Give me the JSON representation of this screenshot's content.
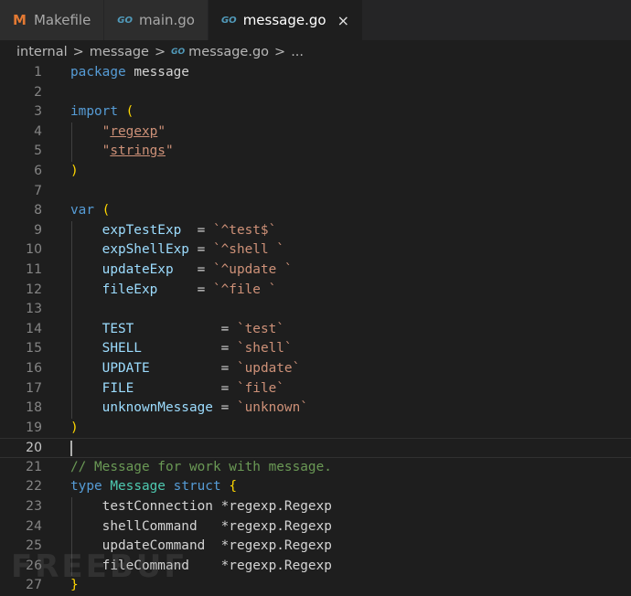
{
  "tabs": [
    {
      "label": "Makefile",
      "icon": "M"
    },
    {
      "label": "main.go",
      "icon": "GO"
    },
    {
      "label": "message.go",
      "icon": "GO",
      "close": "×"
    }
  ],
  "breadcrumb": {
    "folder1": "internal",
    "folder2": "message",
    "file": "message.go",
    "more": "...",
    "sep": ">",
    "file_icon": "GO"
  },
  "lines": [
    {
      "n": "1",
      "tokens": [
        [
          "kw",
          "package"
        ],
        [
          "df",
          " message"
        ]
      ]
    },
    {
      "n": "2",
      "tokens": []
    },
    {
      "n": "3",
      "tokens": [
        [
          "kw",
          "import"
        ],
        [
          "df",
          " "
        ],
        [
          "br",
          "("
        ]
      ]
    },
    {
      "n": "4",
      "tokens": [
        [
          "df",
          "    "
        ],
        [
          "str",
          "\""
        ],
        [
          "strul",
          "regexp"
        ],
        [
          "str",
          "\""
        ]
      ]
    },
    {
      "n": "5",
      "tokens": [
        [
          "df",
          "    "
        ],
        [
          "str",
          "\""
        ],
        [
          "strul",
          "strings"
        ],
        [
          "str",
          "\""
        ]
      ]
    },
    {
      "n": "6",
      "tokens": [
        [
          "br",
          ")"
        ]
      ]
    },
    {
      "n": "7",
      "tokens": []
    },
    {
      "n": "8",
      "tokens": [
        [
          "kw",
          "var"
        ],
        [
          "df",
          " "
        ],
        [
          "br",
          "("
        ]
      ]
    },
    {
      "n": "9",
      "tokens": [
        [
          "df",
          "    "
        ],
        [
          "vr",
          "expTestExp"
        ],
        [
          "df",
          "  = "
        ],
        [
          "str",
          "`^test$`"
        ]
      ]
    },
    {
      "n": "10",
      "tokens": [
        [
          "df",
          "    "
        ],
        [
          "vr",
          "expShellExp"
        ],
        [
          "df",
          " = "
        ],
        [
          "str",
          "`^shell `"
        ]
      ]
    },
    {
      "n": "11",
      "tokens": [
        [
          "df",
          "    "
        ],
        [
          "vr",
          "updateExp"
        ],
        [
          "df",
          "   = "
        ],
        [
          "str",
          "`^update `"
        ]
      ]
    },
    {
      "n": "12",
      "tokens": [
        [
          "df",
          "    "
        ],
        [
          "vr",
          "fileExp"
        ],
        [
          "df",
          "     = "
        ],
        [
          "str",
          "`^file `"
        ]
      ]
    },
    {
      "n": "13",
      "tokens": []
    },
    {
      "n": "14",
      "tokens": [
        [
          "df",
          "    "
        ],
        [
          "vr",
          "TEST"
        ],
        [
          "df",
          "           = "
        ],
        [
          "str",
          "`test`"
        ]
      ]
    },
    {
      "n": "15",
      "tokens": [
        [
          "df",
          "    "
        ],
        [
          "vr",
          "SHELL"
        ],
        [
          "df",
          "          = "
        ],
        [
          "str",
          "`shell`"
        ]
      ]
    },
    {
      "n": "16",
      "tokens": [
        [
          "df",
          "    "
        ],
        [
          "vr",
          "UPDATE"
        ],
        [
          "df",
          "         = "
        ],
        [
          "str",
          "`update`"
        ]
      ]
    },
    {
      "n": "17",
      "tokens": [
        [
          "df",
          "    "
        ],
        [
          "vr",
          "FILE"
        ],
        [
          "df",
          "           = "
        ],
        [
          "str",
          "`file`"
        ]
      ]
    },
    {
      "n": "18",
      "tokens": [
        [
          "df",
          "    "
        ],
        [
          "vr",
          "unknownMessage"
        ],
        [
          "df",
          " = "
        ],
        [
          "str",
          "`unknown`"
        ]
      ]
    },
    {
      "n": "19",
      "tokens": [
        [
          "br",
          ")"
        ]
      ]
    },
    {
      "n": "20",
      "tokens": [],
      "current": true
    },
    {
      "n": "21",
      "tokens": [
        [
          "cm",
          "// Message for work with message."
        ]
      ]
    },
    {
      "n": "22",
      "tokens": [
        [
          "kw",
          "type"
        ],
        [
          "df",
          " "
        ],
        [
          "ty",
          "Message"
        ],
        [
          "df",
          " "
        ],
        [
          "kw",
          "struct"
        ],
        [
          "df",
          " "
        ],
        [
          "br",
          "{"
        ]
      ]
    },
    {
      "n": "23",
      "tokens": [
        [
          "df",
          "    testConnection *regexp.Regexp"
        ]
      ]
    },
    {
      "n": "24",
      "tokens": [
        [
          "df",
          "    shellCommand   *regexp.Regexp"
        ]
      ]
    },
    {
      "n": "25",
      "tokens": [
        [
          "df",
          "    updateCommand  *regexp.Regexp"
        ]
      ]
    },
    {
      "n": "26",
      "tokens": [
        [
          "df",
          "    fileCommand    *regexp.Regexp"
        ]
      ]
    },
    {
      "n": "27",
      "tokens": [
        [
          "br",
          "}"
        ]
      ]
    }
  ],
  "guides": [
    "4",
    "5",
    "9",
    "10",
    "11",
    "12",
    "13",
    "14",
    "15",
    "16",
    "17",
    "18",
    "23",
    "24",
    "25",
    "26"
  ],
  "watermark": "FREEBUF"
}
